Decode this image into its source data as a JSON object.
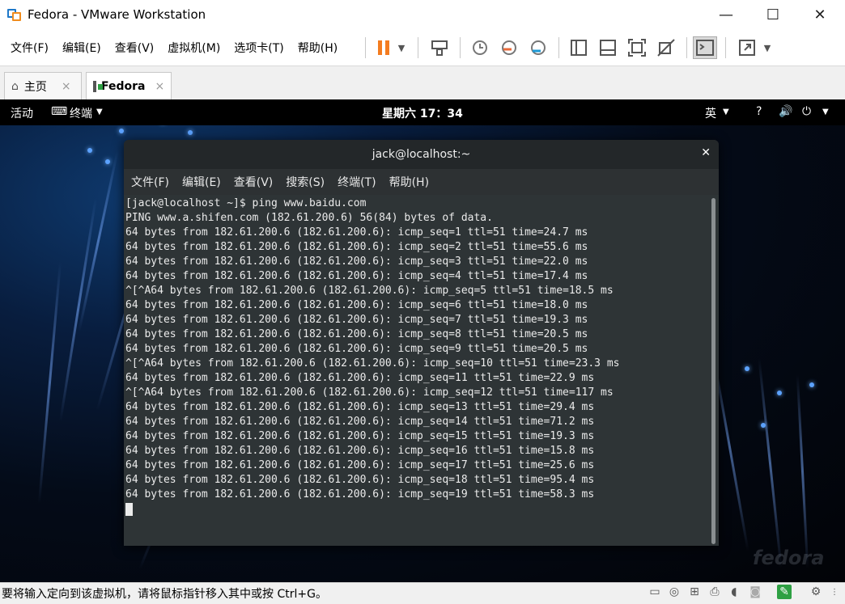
{
  "window": {
    "title": "Fedora - VMware Workstation",
    "minimize": "—",
    "maximize": "☐",
    "close": "✕"
  },
  "menu": [
    "文件(F)",
    "编辑(E)",
    "查看(V)",
    "虚拟机(M)",
    "选项卡(T)",
    "帮助(H)"
  ],
  "tabs": [
    {
      "label": "主页",
      "close": "×"
    },
    {
      "label": "Fedora",
      "close": "×"
    }
  ],
  "gnome": {
    "activities": "活动",
    "app": "终端",
    "clock": "星期六 17：34",
    "input_method": "英"
  },
  "terminal": {
    "title": "jack@localhost:~",
    "menu": [
      "文件(F)",
      "编辑(E)",
      "查看(V)",
      "搜索(S)",
      "终端(T)",
      "帮助(H)"
    ],
    "lines": [
      "[jack@localhost ~]$ ping www.baidu.com",
      "PING www.a.shifen.com (182.61.200.6) 56(84) bytes of data.",
      "64 bytes from 182.61.200.6 (182.61.200.6): icmp_seq=1 ttl=51 time=24.7 ms",
      "64 bytes from 182.61.200.6 (182.61.200.6): icmp_seq=2 ttl=51 time=55.6 ms",
      "64 bytes from 182.61.200.6 (182.61.200.6): icmp_seq=3 ttl=51 time=22.0 ms",
      "64 bytes from 182.61.200.6 (182.61.200.6): icmp_seq=4 ttl=51 time=17.4 ms",
      "^[^A64 bytes from 182.61.200.6 (182.61.200.6): icmp_seq=5 ttl=51 time=18.5 ms",
      "64 bytes from 182.61.200.6 (182.61.200.6): icmp_seq=6 ttl=51 time=18.0 ms",
      "64 bytes from 182.61.200.6 (182.61.200.6): icmp_seq=7 ttl=51 time=19.3 ms",
      "64 bytes from 182.61.200.6 (182.61.200.6): icmp_seq=8 ttl=51 time=20.5 ms",
      "64 bytes from 182.61.200.6 (182.61.200.6): icmp_seq=9 ttl=51 time=20.5 ms",
      "^[^A64 bytes from 182.61.200.6 (182.61.200.6): icmp_seq=10 ttl=51 time=23.3 ms",
      "64 bytes from 182.61.200.6 (182.61.200.6): icmp_seq=11 ttl=51 time=22.9 ms",
      "^[^A64 bytes from 182.61.200.6 (182.61.200.6): icmp_seq=12 ttl=51 time=117 ms",
      "64 bytes from 182.61.200.6 (182.61.200.6): icmp_seq=13 ttl=51 time=29.4 ms",
      "64 bytes from 182.61.200.6 (182.61.200.6): icmp_seq=14 ttl=51 time=71.2 ms",
      "64 bytes from 182.61.200.6 (182.61.200.6): icmp_seq=15 ttl=51 time=19.3 ms",
      "64 bytes from 182.61.200.6 (182.61.200.6): icmp_seq=16 ttl=51 time=15.8 ms",
      "64 bytes from 182.61.200.6 (182.61.200.6): icmp_seq=17 ttl=51 time=25.6 ms",
      "64 bytes from 182.61.200.6 (182.61.200.6): icmp_seq=18 ttl=51 time=95.4 ms",
      "64 bytes from 182.61.200.6 (182.61.200.6): icmp_seq=19 ttl=51 time=58.3 ms"
    ]
  },
  "wallpaper_brand": "fedora",
  "status": "要将输入定向到该虚拟机，请将鼠标指针移入其中或按 Ctrl+G。",
  "icons": [
    "suspend-icon",
    "send-ctrl-alt-del-icon",
    "snapshot-icon",
    "full-screen-icon",
    "console-view-icon"
  ],
  "colors": {
    "terminal_bg": "#2e3436",
    "suspend_orange": "#f47c20",
    "accent_blue": "#1e78c8"
  }
}
